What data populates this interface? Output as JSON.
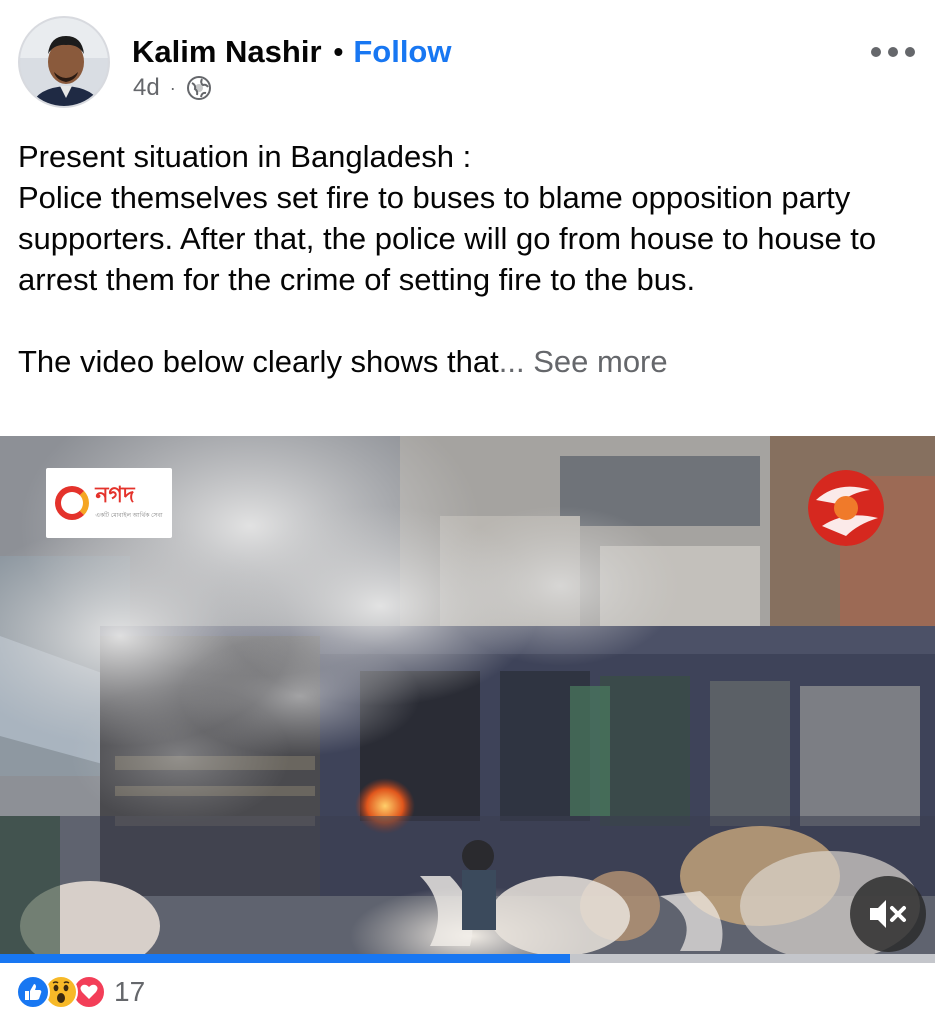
{
  "post": {
    "author": "Kalim Nashir",
    "separator": "•",
    "follow_label": "Follow",
    "time_ago": "4d",
    "meta_separator": "·",
    "audience_icon": "globe-icon",
    "more_icon": "more-options-icon",
    "text_lines": [
      "Present situation in Bangladesh :",
      "Police themselves set fire to buses to blame opposition party supporters. After that, the police will go from house to house to arrest them for the crime of setting fire to the bus."
    ],
    "truncated_text": "The video below clearly shows that",
    "ellipsis": "...",
    "see_more_label": "See more"
  },
  "video": {
    "watermark_left_text": "নগদ",
    "watermark_left_sub": "একটি মোবাইল আর্থিক সেবা",
    "mute_icon": "muted-speaker-icon",
    "progress_fraction": 0.61
  },
  "reactions": {
    "icons": [
      "like-icon",
      "wow-icon",
      "love-icon"
    ],
    "count": "17"
  },
  "colors": {
    "accent": "#1877f2",
    "muted_text": "#65676b",
    "text": "#050505",
    "like": "#1877f2",
    "wow": "#f7b928",
    "love": "#f33e58"
  }
}
